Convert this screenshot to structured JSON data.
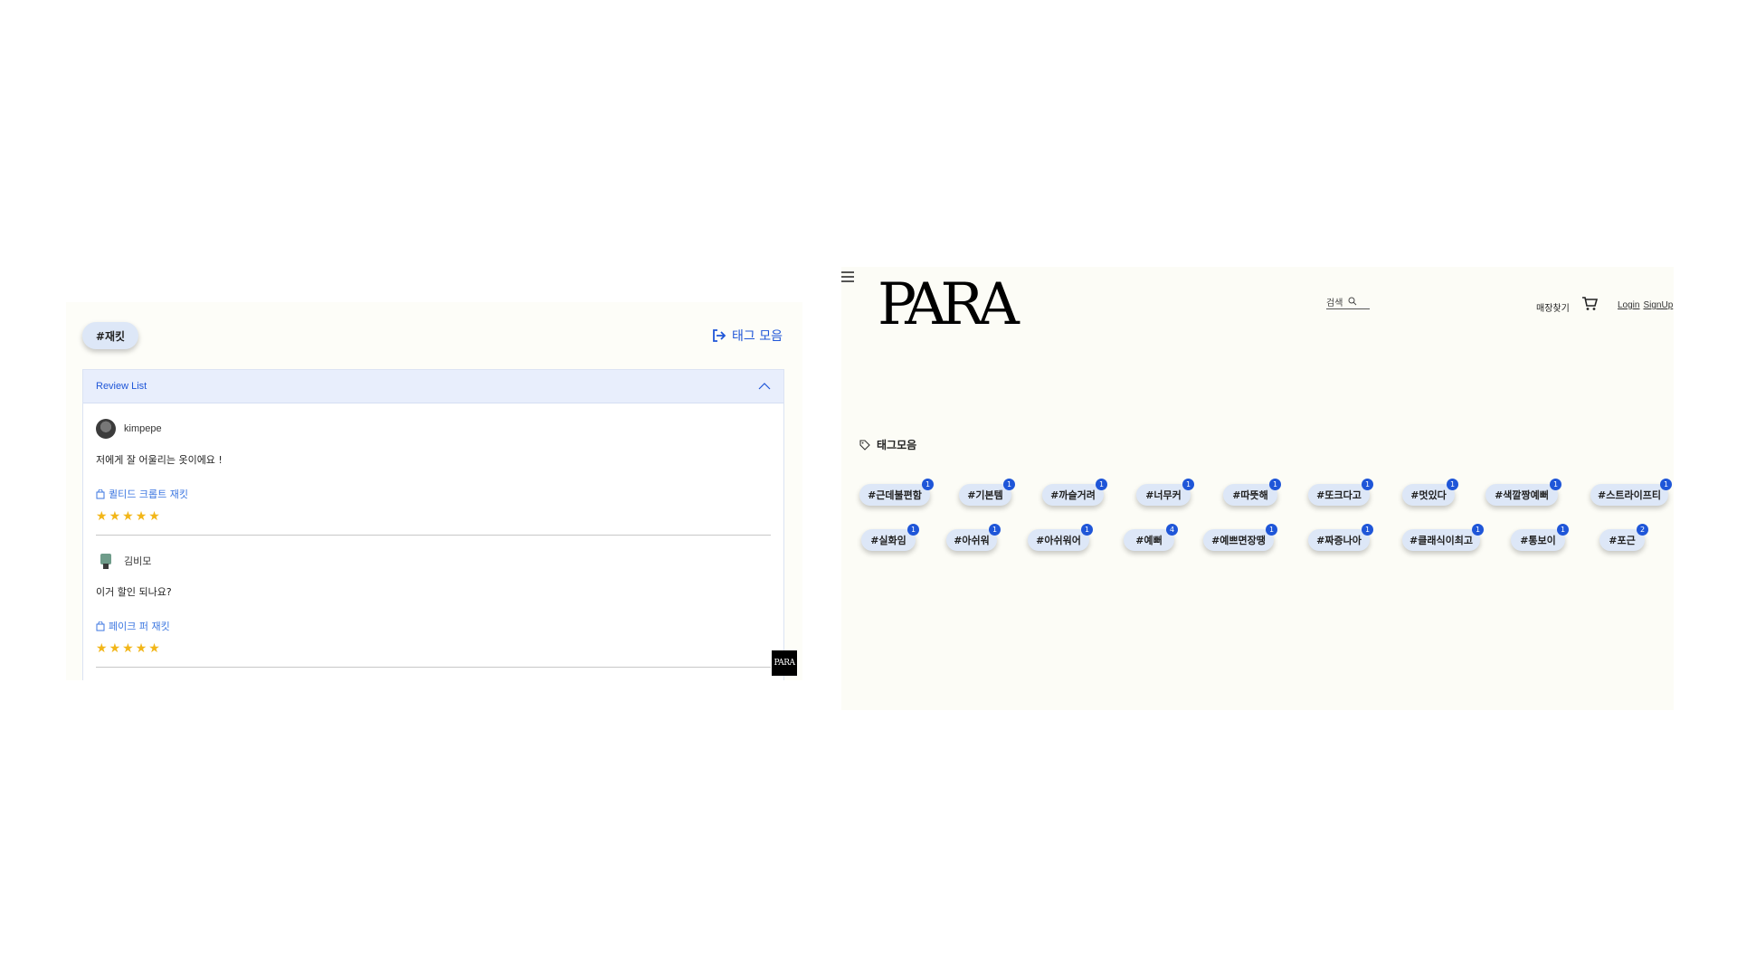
{
  "left": {
    "tag_chip": "#재킷",
    "tag_collection_link": "태그 모음",
    "review_section_title": "Review List",
    "reviews": [
      {
        "name": "kimpepe",
        "text": "저에게 잘 어울리는 옷이에요 !",
        "product": "퀼티드 크롭트 재킷",
        "rating": 5
      },
      {
        "name": "김비모",
        "text": "이거 할인 되나요?",
        "product": "페이크 퍼 재킷",
        "rating": 5
      }
    ],
    "badge": "PARA"
  },
  "right": {
    "logo": "PARA",
    "search_placeholder": "검색",
    "store_locator": "매장찾기",
    "login": "Login",
    "signup": "SignUp",
    "tags_heading": "태그모음",
    "tags_row1": [
      {
        "label": "#근데불편함",
        "count": "1"
      },
      {
        "label": "#기본템",
        "count": "1"
      },
      {
        "label": "#까슬거려",
        "count": "1"
      },
      {
        "label": "#너무커",
        "count": "1"
      },
      {
        "label": "#따뜻해",
        "count": "1"
      },
      {
        "label": "#또크다고",
        "count": "1"
      },
      {
        "label": "#멋있다",
        "count": "1"
      },
      {
        "label": "#색깔짱예뻐",
        "count": "1"
      },
      {
        "label": "#스트라이프티",
        "count": "1"
      }
    ],
    "tags_row2": [
      {
        "label": "#실화임",
        "count": "1"
      },
      {
        "label": "#아쉬워",
        "count": "1"
      },
      {
        "label": "#아쉬워어",
        "count": "1"
      },
      {
        "label": "#예뻐",
        "count": "4"
      },
      {
        "label": "#예쁘면장땡",
        "count": "1"
      },
      {
        "label": "#짜증나아",
        "count": "1"
      },
      {
        "label": "#클래식이최고",
        "count": "1"
      },
      {
        "label": "#통보이",
        "count": "1"
      },
      {
        "label": "#포근",
        "count": "2"
      }
    ]
  },
  "colors": {
    "accent": "#1f56d8",
    "chip_bg": "#dde7f7",
    "star": "#f2b619"
  }
}
